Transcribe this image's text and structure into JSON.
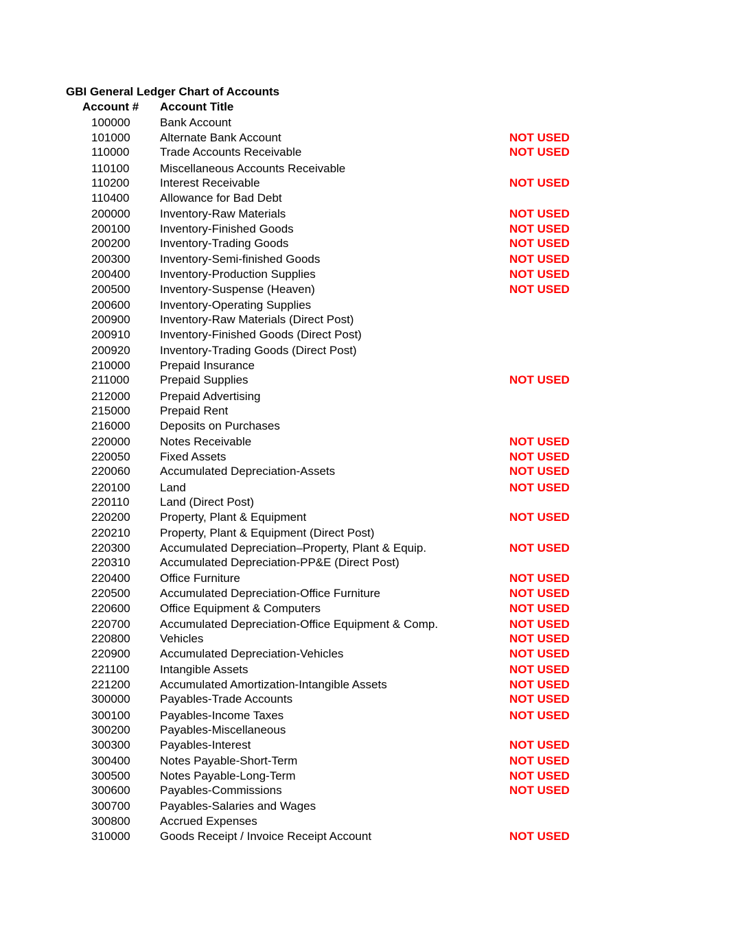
{
  "document": {
    "title": "GBI General Ledger Chart of Accounts",
    "headers": {
      "account_number": "Account #",
      "account_title": "Account Title"
    },
    "status_color": "#ff0000",
    "rows": [
      {
        "number": "100000",
        "title": "Bank Account",
        "status": ""
      },
      {
        "number": "101000",
        "title": "Alternate Bank Account",
        "status": "NOT USED"
      },
      {
        "number": "110000",
        "title": "Trade Accounts Receivable",
        "status": "NOT USED"
      },
      {
        "number": "110100",
        "title": "Miscellaneous Accounts Receivable",
        "status": ""
      },
      {
        "number": "110200",
        "title": "Interest Receivable",
        "status": "NOT USED"
      },
      {
        "number": "110400",
        "title": "Allowance for Bad Debt",
        "status": ""
      },
      {
        "number": "200000",
        "title": "Inventory-Raw Materials",
        "status": "NOT USED"
      },
      {
        "number": "200100",
        "title": "Inventory-Finished Goods",
        "status": "NOT USED"
      },
      {
        "number": "200200",
        "title": "Inventory-Trading Goods",
        "status": "NOT USED"
      },
      {
        "number": "200300",
        "title": "Inventory-Semi-finished Goods",
        "status": "NOT USED"
      },
      {
        "number": "200400",
        "title": "Inventory-Production Supplies",
        "status": "NOT USED"
      },
      {
        "number": "200500",
        "title": "Inventory-Suspense (Heaven)",
        "status": "NOT USED"
      },
      {
        "number": "200600",
        "title": "Inventory-Operating Supplies",
        "status": ""
      },
      {
        "number": "200900",
        "title": "Inventory-Raw Materials (Direct Post)",
        "status": ""
      },
      {
        "number": "200910",
        "title": "Inventory-Finished Goods (Direct Post)",
        "status": ""
      },
      {
        "number": "200920",
        "title": "Inventory-Trading Goods (Direct Post)",
        "status": ""
      },
      {
        "number": "210000",
        "title": "Prepaid Insurance",
        "status": ""
      },
      {
        "number": "211000",
        "title": "Prepaid Supplies",
        "status": "NOT USED"
      },
      {
        "number": "212000",
        "title": "Prepaid Advertising",
        "status": ""
      },
      {
        "number": "215000",
        "title": "Prepaid Rent",
        "status": ""
      },
      {
        "number": "216000",
        "title": "Deposits on Purchases",
        "status": ""
      },
      {
        "number": "220000",
        "title": "Notes Receivable",
        "status": "NOT USED"
      },
      {
        "number": "220050",
        "title": "Fixed Assets",
        "status": "NOT USED"
      },
      {
        "number": "220060",
        "title": "Accumulated Depreciation-Assets",
        "status": "NOT USED"
      },
      {
        "number": "220100",
        "title": "Land",
        "status": "NOT USED"
      },
      {
        "number": "220110",
        "title": "Land (Direct Post)",
        "status": ""
      },
      {
        "number": "220200",
        "title": "Property, Plant & Equipment",
        "status": "NOT USED"
      },
      {
        "number": "220210",
        "title": "Property, Plant & Equipment (Direct Post)",
        "status": ""
      },
      {
        "number": "220300",
        "title": "Accumulated Depreciation–Property, Plant & Equip.",
        "status": "NOT USED"
      },
      {
        "number": "220310",
        "title": "Accumulated Depreciation-PP&E (Direct Post)",
        "status": ""
      },
      {
        "number": "220400",
        "title": "Office Furniture",
        "status": "NOT USED"
      },
      {
        "number": "220500",
        "title": "Accumulated Depreciation-Office Furniture",
        "status": "NOT USED"
      },
      {
        "number": "220600",
        "title": "Office Equipment & Computers",
        "status": "NOT USED"
      },
      {
        "number": "220700",
        "title": "Accumulated Depreciation-Office Equipment & Comp.",
        "status": "NOT USED"
      },
      {
        "number": "220800",
        "title": "Vehicles",
        "status": "NOT USED"
      },
      {
        "number": "220900",
        "title": "Accumulated Depreciation-Vehicles",
        "status": "NOT USED"
      },
      {
        "number": "221100",
        "title": "Intangible Assets",
        "status": "NOT USED"
      },
      {
        "number": "221200",
        "title": "Accumulated Amortization-Intangible Assets",
        "status": "NOT USED"
      },
      {
        "number": "300000",
        "title": "Payables-Trade Accounts",
        "status": "NOT USED"
      },
      {
        "number": "300100",
        "title": "Payables-Income Taxes",
        "status": "NOT USED"
      },
      {
        "number": "300200",
        "title": "Payables-Miscellaneous",
        "status": ""
      },
      {
        "number": "300300",
        "title": "Payables-Interest",
        "status": "NOT USED"
      },
      {
        "number": "300400",
        "title": "Notes Payable-Short-Term",
        "status": "NOT USED"
      },
      {
        "number": "300500",
        "title": "Notes Payable-Long-Term",
        "status": "NOT USED"
      },
      {
        "number": "300600",
        "title": "Payables-Commissions",
        "status": "NOT USED"
      },
      {
        "number": "300700",
        "title": "Payables-Salaries and Wages",
        "status": ""
      },
      {
        "number": "300800",
        "title": "Accrued Expenses",
        "status": ""
      },
      {
        "number": "310000",
        "title": "Goods Receipt / Invoice Receipt Account",
        "status": "NOT USED"
      }
    ]
  }
}
